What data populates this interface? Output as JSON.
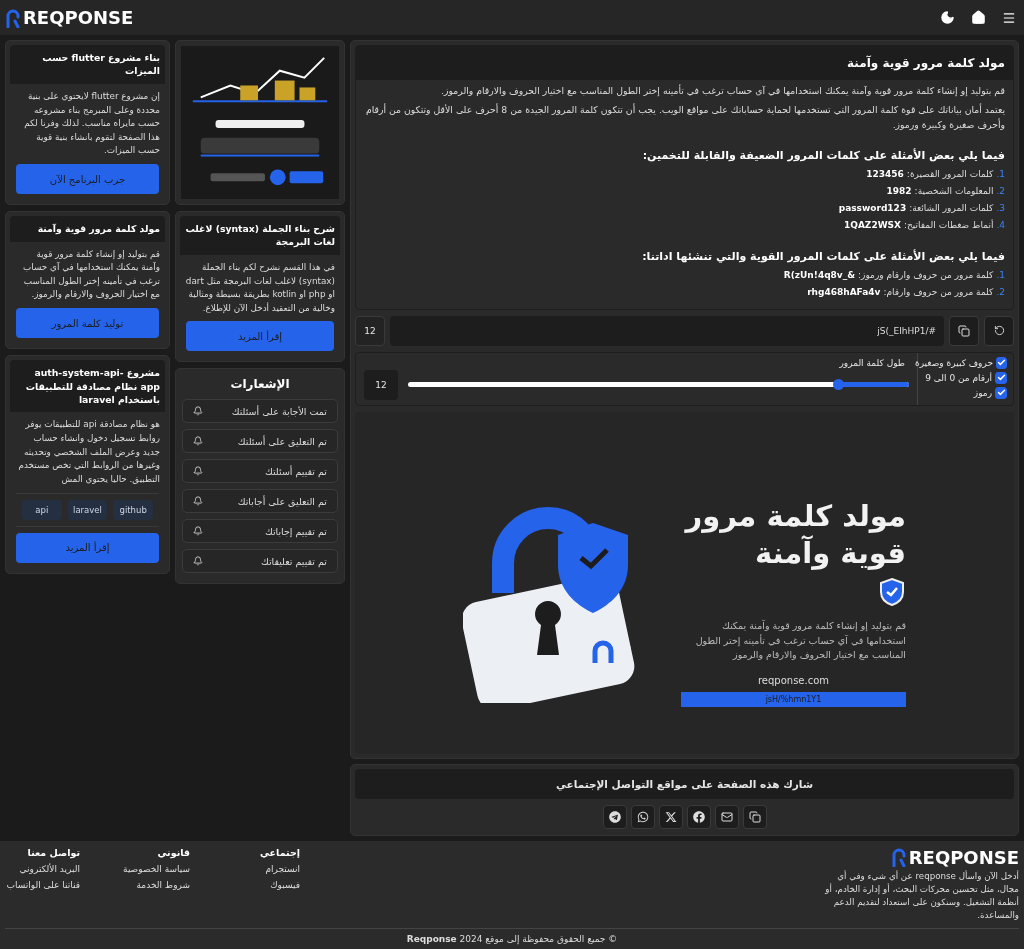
{
  "header": {
    "logo": "REQPONSE"
  },
  "left_cards": [
    {
      "title": "بناء مشروع flutter حسب الميزات",
      "body": "إن مشروع flutter لايحتوي على بنية محددة وعلى المبرمج بناء مشروعه حسب مايراه مناسب. لذلك وفرنا لكم هذا الصفحة لتقوم بانشاء بنية قوية حسب الميزات.",
      "button": "جرب البرنامج الآن"
    },
    {
      "title": "مولد كلمة مرور قوية وآمنة",
      "body": "قم بتوليد إو إنشاء كلمة مرور قوية وآمنة يمكنك استخدامها في آي حساب ترغب في تأمينه إختر الطول المناسب مع اختيار الحروف والارقام والرموز.",
      "button": "توليد كلمة المرور"
    },
    {
      "title": "مشروع auth-system-api-app نظام مصادقة للتطبيقات باستخدام laravel",
      "body": "هو نظام مصادقة api للتطبيقات يوفر روابط تسجيل دخول وانشاء حساب جديد وعرض الملف الشخصي وتحديثه وغيرها من الروابط التي تخص مستخدم التطبيق. حاليا يحتوي المش",
      "tags": [
        "github",
        "laravel",
        "api"
      ],
      "button": "إقرأ المزيد"
    }
  ],
  "middle": {
    "card": {
      "title": "شرح بناء الجملة (syntax) لاغلب لغات البرمجة",
      "body": "في هذا القسم نشرح لكم بناء الجملة (syntax) لاغلب لغات البرمجة مثل dart او php او kotlin بطريقة بسيطة ومثالية وخالية من التعقيد أدخل الآن للإطلاع.",
      "button": "إقرأ المزيد"
    },
    "notifications": {
      "title": "الإشعارات",
      "items": [
        "تمت الأجابة على أسئلتك",
        "تم التعليق على أسئلتك",
        "تم تقييم أسئلتك",
        "تم التعليق على أجاباتك",
        "تم تقييم إجاباتك",
        "تم تقييم تعليقاتك"
      ]
    }
  },
  "main": {
    "title": "مولد كلمة مرور قوية وآمنة",
    "paragraphs": [
      "قم بتوليد إو إنشاء كلمة مرور قوية وآمنة يمكنك استخدامها في آي حساب ترغب في تأمينه إختر الطول المناسب مع اختيار الحروف والارقام والرموز.",
      "يعتمد أمان بياناتك على قوة كلمة المرور التي تستخدمها لحماية حساباتك على مواقع الويب. يجب أن تتكون كلمة المرور الجيدة من 8 أحرف على الأقل وتتكون من أرقام وأحرف صغيرة وكبيرة ورموز."
    ],
    "lists": [
      {
        "heading": "فيما يلي بعض الأمثلة على كلمات المرور الضعيفة والقابلة للتخمين:",
        "items": [
          {
            "number": "1.",
            "label": "كلمات المرور القصيرة:",
            "value": "123456"
          },
          {
            "number": "2.",
            "label": "المعلومات الشخصية:",
            "value": "1982"
          },
          {
            "number": "3.",
            "label": "كلمات المرور الشائعة:",
            "value": "password123"
          },
          {
            "number": "4.",
            "label": "أنماط ضغطات المفاتيح:",
            "value": "1QAZ2WSX"
          }
        ]
      },
      {
        "heading": "فيما يلي بعض الأمثلة على كلمات المرور القوية والتي تنشئها اداتنا:",
        "items": [
          {
            "number": "1.",
            "label": "كلمة مرور من حروف وارقام ورموز:",
            "value": "R(zUn!4q8v_&"
          },
          {
            "number": "2.",
            "label": "كلمة مرور من حروف وارقام:",
            "value": "rhg468hAFa4v"
          }
        ]
      }
    ],
    "generator": {
      "password": "jS(_EIhHP1/#",
      "length": "12"
    },
    "options": [
      {
        "label": "حروف كبيرة وصغيرة",
        "checked": true
      },
      {
        "label": "أرقام من 0 الى 9",
        "checked": true
      },
      {
        "label": "رموز",
        "checked": true
      }
    ],
    "slider": {
      "label": "طول كلمة المرور",
      "value": "12",
      "level": 0.14
    },
    "banner": {
      "title": "مولد كلمة مرور قوية وآمنة",
      "description": "قم بتوليد إو إنشاء كلمة مرور قوية وآمنة يمكنك استخدامها في آي حساب ترغب في تأمينه إختر الطول المناسب مع اختيار الحروف والارقام والرموز",
      "site": "reqponse.com",
      "password": "jsH/%hmn1Y1"
    },
    "share": {
      "title": "شارك هذه الصفحة على مواقع التواصل الإجتماعي",
      "buttons": [
        {
          "kind": "copy"
        },
        {
          "kind": "email"
        },
        {
          "kind": "facebook"
        },
        {
          "kind": "x"
        },
        {
          "kind": "whatsapp"
        },
        {
          "kind": "telegram"
        }
      ]
    }
  },
  "footer": {
    "logo": "REQPONSE",
    "description": "أدخل الآن واسأل reqponse عن أي شيء وفي أي مجال، مثل تحسين محركات البحث، أو إدارة الخادم، أو أنظمة التشغيل. وسنكون على استعداد لتقديم الدعم والمساعدة.",
    "columns": [
      {
        "title": "إجتماعي",
        "links": [
          "انستجرام",
          "فيسبوك"
        ]
      },
      {
        "title": "قانوني",
        "links": [
          "سياسة الخصوصية",
          "شروط الخدمة"
        ]
      },
      {
        "title": "تواصل معنا",
        "links": [
          "البريد الألكتروني",
          "قناتنا على الواتساب"
        ]
      }
    ],
    "copyright": "© جميع الحقوق محفوظة إلى موقع **Reqponse** 2024"
  }
}
